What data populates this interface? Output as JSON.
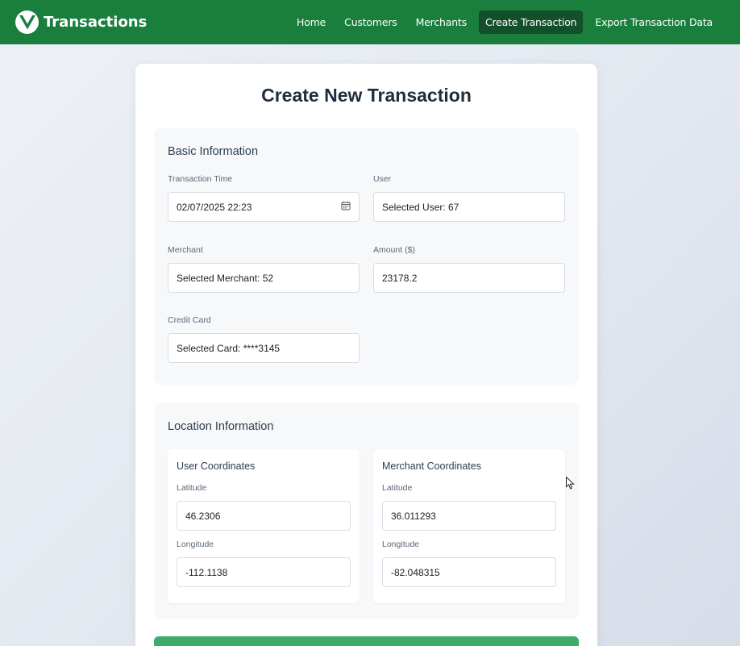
{
  "navbar": {
    "title": "Transactions",
    "links": [
      {
        "label": "Home"
      },
      {
        "label": "Customers"
      },
      {
        "label": "Merchants"
      },
      {
        "label": "Create Transaction",
        "active": true
      },
      {
        "label": "Export Transaction Data"
      }
    ],
    "color": "#1a7f3c",
    "active_color": "#13502a"
  },
  "page": {
    "title": "Create New Transaction"
  },
  "basic": {
    "title": "Basic Information",
    "transaction_time": {
      "label": "Transaction Time",
      "value": "02/07/2025 22:23",
      "icon": "calendar-icon"
    },
    "user": {
      "label": "User",
      "value": "Selected User: 67"
    },
    "merchant": {
      "label": "Merchant",
      "value": "Selected Merchant: 52"
    },
    "amount": {
      "label": "Amount ($)",
      "value": "23178.2"
    },
    "credit_card": {
      "label": "Credit Card",
      "value": "Selected Card: ****3145"
    }
  },
  "location": {
    "title": "Location Information",
    "user_coords": {
      "title": "User Coordinates",
      "latitude": {
        "label": "Latitude",
        "value": "46.2306"
      },
      "longitude": {
        "label": "Longitude",
        "value": "-112.1138"
      }
    },
    "merchant_coords": {
      "title": "Merchant Coordinates",
      "latitude": {
        "label": "Latitude",
        "value": "36.011293"
      },
      "longitude": {
        "label": "Longitude",
        "value": "-82.048315"
      }
    }
  },
  "submit": {
    "color": "#3faa6b"
  }
}
